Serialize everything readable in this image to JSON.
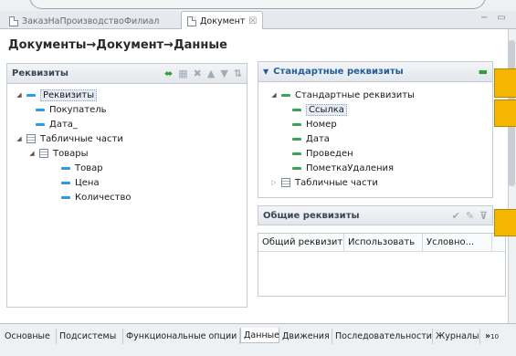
{
  "tabs": [
    {
      "label": "ЗаказНаПроизводствоФилиал",
      "active": false
    },
    {
      "label": "Документ",
      "active": true,
      "close": "☒"
    }
  ],
  "window_controls": {
    "minimize": "−",
    "maximize": "▭"
  },
  "breadcrumb": "Документы→Документ→Данные",
  "left_panel": {
    "title": "Реквизиты",
    "tree": [
      {
        "label": "Реквизиты"
      },
      {
        "label": "Покупатель"
      },
      {
        "label": "Дата_"
      },
      {
        "label": "Табличные части"
      },
      {
        "label": "Товары"
      },
      {
        "label": "Товар"
      },
      {
        "label": "Цена"
      },
      {
        "label": "Количество"
      }
    ]
  },
  "right_panel": {
    "title": "Стандартные реквизиты",
    "tree": [
      {
        "label": "Стандартные реквизиты"
      },
      {
        "label": "Ссылка"
      },
      {
        "label": "Номер"
      },
      {
        "label": "Дата"
      },
      {
        "label": "Проведен"
      },
      {
        "label": "ПометкаУдаления"
      },
      {
        "label": "Табличные части"
      }
    ]
  },
  "common_panel": {
    "title": "Общие реквизиты",
    "columns": [
      "Общий реквизит",
      "Использовать",
      "Условно..."
    ]
  },
  "bottom_tabs": [
    {
      "label": "Основные"
    },
    {
      "label": "Подсистемы"
    },
    {
      "label": "Функциональные опции"
    },
    {
      "label": "Данные",
      "active": true
    },
    {
      "label": "Движения"
    },
    {
      "label": "Последовательности"
    },
    {
      "label": "Журналы"
    }
  ],
  "overflow": {
    "chevron": "»",
    "count": "10"
  },
  "colors": {
    "accent_blue": "#2a9de6",
    "standard_green": "#3aa655",
    "highlight_orange": "#f6b500"
  }
}
